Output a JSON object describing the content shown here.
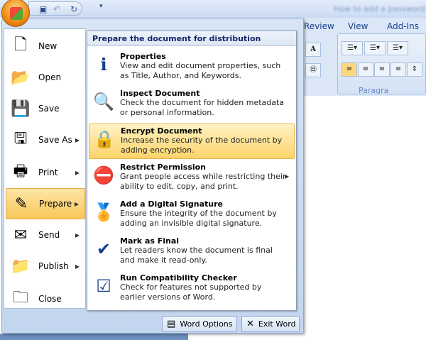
{
  "window": {
    "title": "How to add a password"
  },
  "qat": {
    "save": "save-icon",
    "undo": "undo-icon",
    "redo": "redo-icon",
    "customize": "customize-icon"
  },
  "ribbon": {
    "tabs": [
      "Review",
      "View",
      "Add-Ins"
    ],
    "group_label": "Paragra"
  },
  "left_menu": [
    {
      "label": "New",
      "icon": "new-document-icon",
      "arrow": false
    },
    {
      "label": "Open",
      "icon": "open-folder-icon",
      "arrow": false
    },
    {
      "label": "Save",
      "icon": "save-icon",
      "arrow": false
    },
    {
      "label": "Save As",
      "icon": "save-as-icon",
      "arrow": true
    },
    {
      "label": "Print",
      "icon": "printer-icon",
      "arrow": true
    },
    {
      "label": "Prepare",
      "icon": "prepare-icon",
      "arrow": true,
      "selected": true
    },
    {
      "label": "Send",
      "icon": "send-icon",
      "arrow": true
    },
    {
      "label": "Publish",
      "icon": "publish-icon",
      "arrow": true
    },
    {
      "label": "Close",
      "icon": "close-folder-icon",
      "arrow": false
    }
  ],
  "submenu": {
    "header": "Prepare the document for distribution",
    "items": [
      {
        "title": "Properties",
        "desc": "View and edit document properties, such as Title, Author, and Keywords.",
        "icon": "properties-icon"
      },
      {
        "title": "Inspect Document",
        "desc": "Check the document for hidden metadata or personal information.",
        "icon": "inspect-document-icon"
      },
      {
        "title": "Encrypt Document",
        "desc": "Increase the security of the document by adding encryption.",
        "icon": "encrypt-lock-icon",
        "selected": true
      },
      {
        "title": "Restrict Permission",
        "desc": "Grant people access while restricting their ability to edit, copy, and print.",
        "icon": "restrict-permission-icon",
        "arrow": true
      },
      {
        "title": "Add a Digital Signature",
        "desc": "Ensure the integrity of the document by adding an invisible digital signature.",
        "icon": "digital-signature-icon"
      },
      {
        "title": "Mark as Final",
        "desc": "Let readers know the document is final and make it read-only.",
        "icon": "mark-final-icon"
      },
      {
        "title": "Run Compatibility Checker",
        "desc": "Check for features not supported by earlier versions of Word.",
        "icon": "compatibility-checker-icon"
      }
    ]
  },
  "footer": {
    "options": "Word Options",
    "exit": "Exit Word"
  }
}
